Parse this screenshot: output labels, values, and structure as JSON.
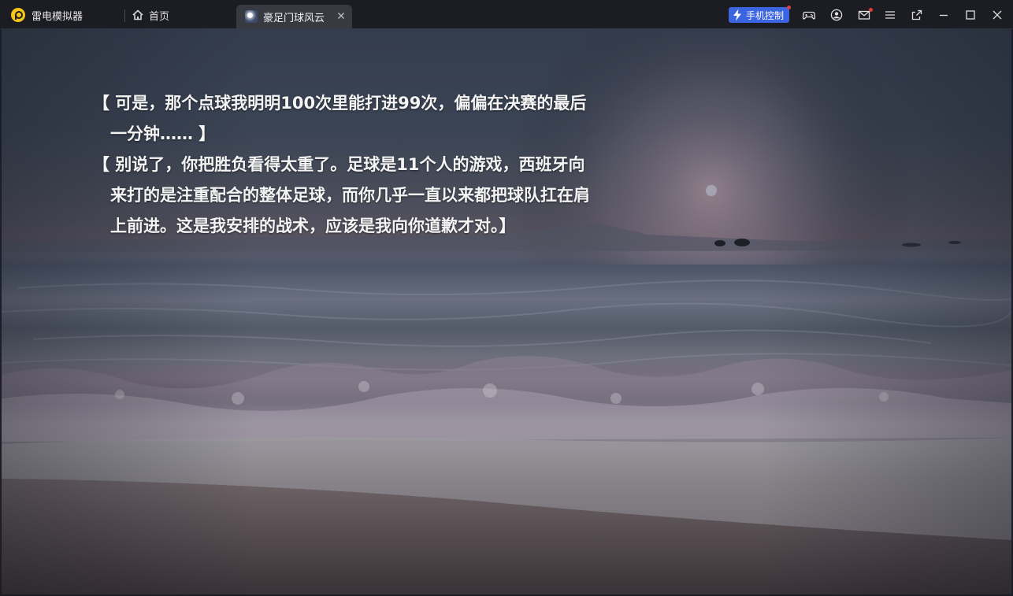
{
  "titlebar": {
    "app_name": "雷电模拟器",
    "home_tab_label": "首页",
    "game_tab_label": "豪足门球风云",
    "phone_control_label": "手机控制",
    "icons": [
      "gamepad-icon",
      "account-icon",
      "mail-icon",
      "menu-icon",
      "popout-icon",
      "minimize-icon",
      "maximize-icon",
      "close-icon"
    ]
  },
  "colors": {
    "titlebar_bg": "#1c1d22",
    "active_tab_bg": "#383a42",
    "accent_blue": "#3a64e0",
    "logo_yellow": "#f5c518",
    "notification_red": "#e23b3b"
  },
  "game": {
    "dialogue": [
      "【 可是，那个点球我明明100次里能打进99次，偏偏在决赛的最后一分钟…… 】",
      "【 别说了，你把胜负看得太重了。足球是11个人的游戏，西班牙向来打的是注重配合的整体足球，而你几乎一直以来都把球队扛在肩上前进。这是我安排的战术，应该是我向你道歉才对。】"
    ],
    "background": "sea-at-dusk"
  }
}
